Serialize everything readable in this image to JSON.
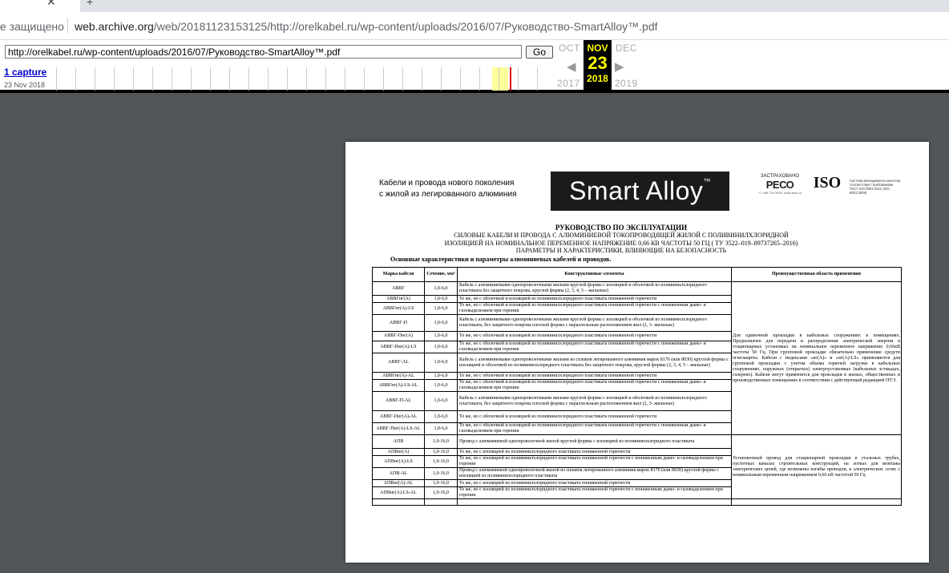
{
  "browser": {
    "security_label": "е защищено",
    "url_host": "web.archive.org",
    "url_path": "/web/20181123153125/http://orelkabel.ru/wp-content/uploads/2016/07/Руководство-SmartAlloy™.pdf"
  },
  "wayback": {
    "input_value": "http://orelkabel.ru/wp-content/uploads/2016/07/Руководство-SmartAlloy™.pdf",
    "go_label": "Go",
    "captures_label": "1 capture",
    "capture_date": "23 Nov 2018",
    "prev_month": "OCT",
    "cur_month": "NOV",
    "next_month": "DEC",
    "cur_day": "23",
    "prev_year": "2017",
    "cur_year": "2018",
    "next_year": "2019"
  },
  "document": {
    "tagline_1": "Кабели и провода нового поколения",
    "tagline_2": "с жилой из легированного алюминия",
    "logo_text": "Smart Alloy",
    "logo_mark": "™",
    "reso_top": "ЗАСТРАХОВАНО",
    "reso_name": "РЕСО",
    "reso_sub": "+7 495 730 3000, www.reso.ru",
    "iso_text": "ISO",
    "iso_note": "Система менеджмента качества соответствует требованиям ГОСТ ISO 9001-2011 (ISO 9001:2008)",
    "title": "РУКОВОДСТВО ПО ЭКСПЛУАТАЦИИ",
    "sub1": "СИЛОВЫЕ КАБЕЛИ И ПРОВОДА С АЛЮМИНИЕВОЙ ТОКОПРОВОДЯЩЕЙ ЖИЛОЙ С ПОЛИВИНИЛХЛОРИДНОЙ",
    "sub2": "ИЗОЛЯЦИЕЙ НА НОМИНАЛЬНОЕ ПЕРЕМЕННОЕ НАПРЯЖЕНИЕ 0,66 КВ ЧАСТОТЫ 50 ГЦ ( ТУ 3522–019–89737265–2016)",
    "sub3": "ПАРАМЕТРЫ И ХАРАКТЕРИСТИКИ, ВЛИЯЮЩИЕ НА БЕЗОПАСНОСТЬ",
    "section": "Основные характеристики и параметры алюминиевых кабелей и проводов.",
    "columns": [
      "Марка кабеля",
      "Сечение, мм²",
      "Конструктивные элементы",
      "Преимущественная область применения"
    ],
    "rows": [
      [
        "АВВГ",
        "1,0-6,0",
        "Кабель с алюминиевыми однопроволочными жилами круглой формы с изоляцией и оболочкой из поливинилхлоридного пластиката без защитного покрова, круглой формы (2, 3, 4, 5 – жильные)"
      ],
      [
        "АВВГнг(А)",
        "1,0-6,0",
        "То же, но с оболочкой и изоляцией из поливинилхлоридного пластиката пониженной горючести"
      ],
      [
        "АВВГнг(А)-LS",
        "1,0-6,0",
        "То же, но с оболочкой и изоляцией из поливинилхлоридного пластиката пониженной горючести с пониженным дымо- и газовыделением при горении"
      ],
      [
        "АВВГ-П",
        "1,0-6,0",
        "Кабель с алюминиевыми однопроволочными жилами круглой формы с изоляцией и оболочкой из поливинилхлоридного пластиката, без защитного покрова плоской формы с параллельным расположением жил (2, 3- жильные)"
      ],
      [
        "АВВГ-Пнг(А)",
        "1,0-6,0",
        "То же, но с оболочкой и изоляцией из поливинилхлоридного пластиката пониженной горючести"
      ],
      [
        "АВВГ-Пнг(А)-LS",
        "1,0-6,0",
        "То же, но с оболочкой и изоляцией из поливинилхлоридного пластиката пониженной горючести с пониженным дымо- и газовыделением при горении"
      ],
      [
        "АВВГ-AL",
        "1,0-6,0",
        "Кабель с алюминиевыми однопроволочными жилами из сплавов легированного алюминия марок 8176 (или 8030) круглой формы с изоляцией и оболочкой из поливинилхлоридного пластиката без защитного покрова, круглой формы (2, 3, 4, 5 – жильные)"
      ],
      [
        "АВВГнг(А)-AL",
        "1,0-6,0",
        "То же, но с оболочкой и изоляцией из поливинилхлоридного пластиката пониженной горючести"
      ],
      [
        "АВВГнг(А)-LS-AL",
        "1,0-6,0",
        "То же, но с оболочкой и изоляцией из поливинилхлоридного пластиката пониженной горючести с пониженным дымо- и газовыделением при горении"
      ],
      [
        "АВВГ-П-AL",
        "1,0-6,0",
        "Кабель с алюминиевыми однопроволочными жилами круглой формы с изоляцией и оболочкой из поливинилхлоридного пластиката, без защитного покрова плоской формы с параллельным расположением жил (2, 3- жильные)"
      ],
      [
        "АВВГ-Пнг(А)-AL",
        "1,0-6,0",
        "То же, но с оболочкой и изоляцией из поливинилхлоридного пластиката пониженной горючести"
      ],
      [
        "АВВГ-Пнг(А)-LS-AL",
        "1,0-6,0",
        "То же, но с оболочкой и изоляцией из поливинилхлоридного пластиката пониженной горючести с пониженным дымо- и газовыделением при горении"
      ],
      [
        "АПВ",
        "1,0-16,0",
        "Провод с алюминиевой однопроволочной жилой круглой формы с изоляцией из поливинилхлоридного пластиката"
      ],
      [
        "АПВнг(А)",
        "1,0-16,0",
        "То же, но с изоляцией из поливинилхлоридного пластиката пониженной горючести"
      ],
      [
        "АПВнг(А)-LS",
        "1,0-16,0",
        "То же, но с изоляцией из поливинилхлоридного пластиката пониженной горючести с пониженным дымо- и газовыделением при горении"
      ],
      [
        "АПВ-AL",
        "1,0-16,0",
        "Провод с алюминиевой однопроволочной жилой из сплавов легированного алюминия марок 8176 (или 8030) круглой формы с изоляцией из поливинилхлоридного пластиката"
      ],
      [
        "АПВнг(А)-AL",
        "1,0-16,0",
        "То же, но с изоляцией из поливинилхлоридного пластиката пониженной горючести"
      ],
      [
        "АПВнг(А)-LS-AL",
        "1,0-16,0",
        "То же, но с изоляцией из поливинилхлоридного пластиката пониженной горючести с пониженным дымо- и газовыделением при горении"
      ]
    ],
    "app_cables": "Для одиночной прокладки в кабельных сооружениях в помещениях. Предназначен для передачи и распределения электрической энергии в стационарных установках на номинальное переменное напряжение 0,66кВ частоты 50 Гц. При групповой прокладке обязательно применение средств огнезащиты. Кабели с индексами «нг(А)» и «нг(А)-LS» применяются для групповой прокладки с учетом объема горючей загрузки в кабельных сооружениях, наружных (открытых) электроустановках (кабельных эстакадах, галереях). Кабели могут применятся для прокладки в жилых, общественных и производственных помещениях в соответствии с действующей редакцией ПУЭ.",
    "app_wires": "Установочный провод для стационарной прокладки в стальных трубах, пустотных каналах строительных конструкций, на лотках для монтажа электрических цепей, где возможны изгибы проводов, в электрических сетях с номинальным переменным напряжением 0,66 кВ частотой 50 Гц"
  }
}
